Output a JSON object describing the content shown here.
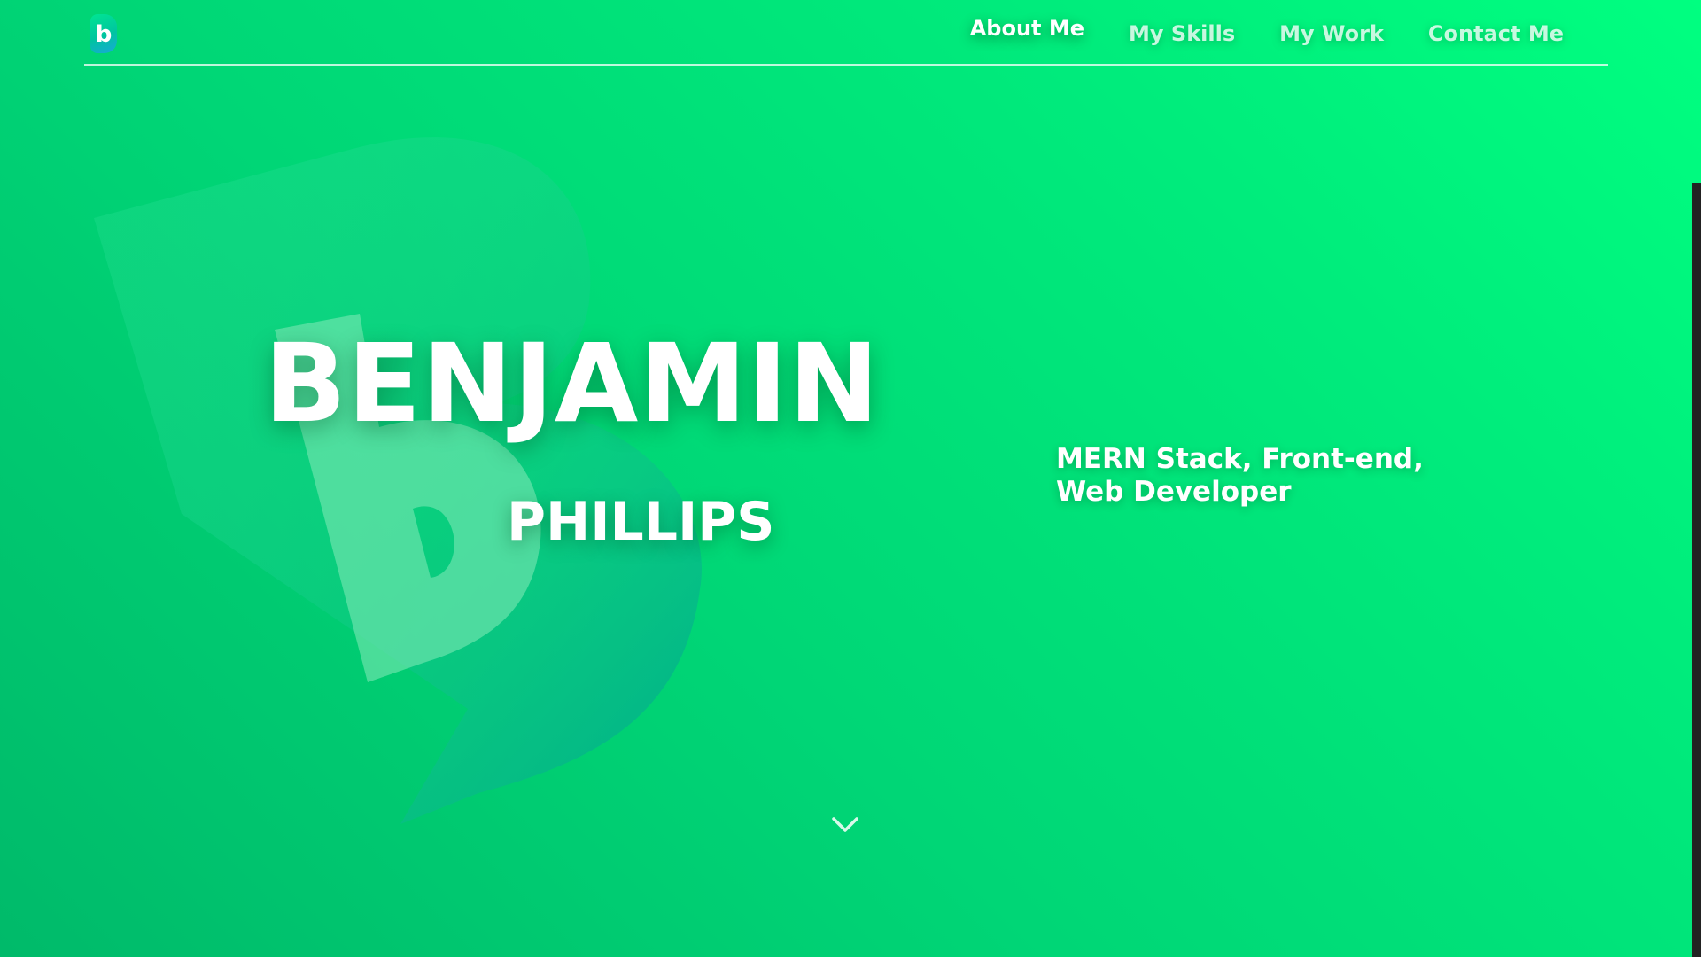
{
  "colors": {
    "gradient_start": "#00ba6a",
    "gradient_end": "#00ff80",
    "text": "#ffffff",
    "scrollbar": "#222222"
  },
  "logo": {
    "letter": "b",
    "icon": "b-monogram-icon"
  },
  "nav": {
    "items": [
      {
        "label": "About Me",
        "active": true
      },
      {
        "label": "My Skills",
        "active": false
      },
      {
        "label": "My Work",
        "active": false
      },
      {
        "label": "Contact Me",
        "active": false
      }
    ]
  },
  "hero": {
    "first_name": "BENJAMIN",
    "last_name": "PHILLIPS",
    "tagline": "MERN Stack, Front-end, Web Developer",
    "scroll_icon": "chevron-down-icon",
    "background_icon": "b-monogram-icon"
  }
}
